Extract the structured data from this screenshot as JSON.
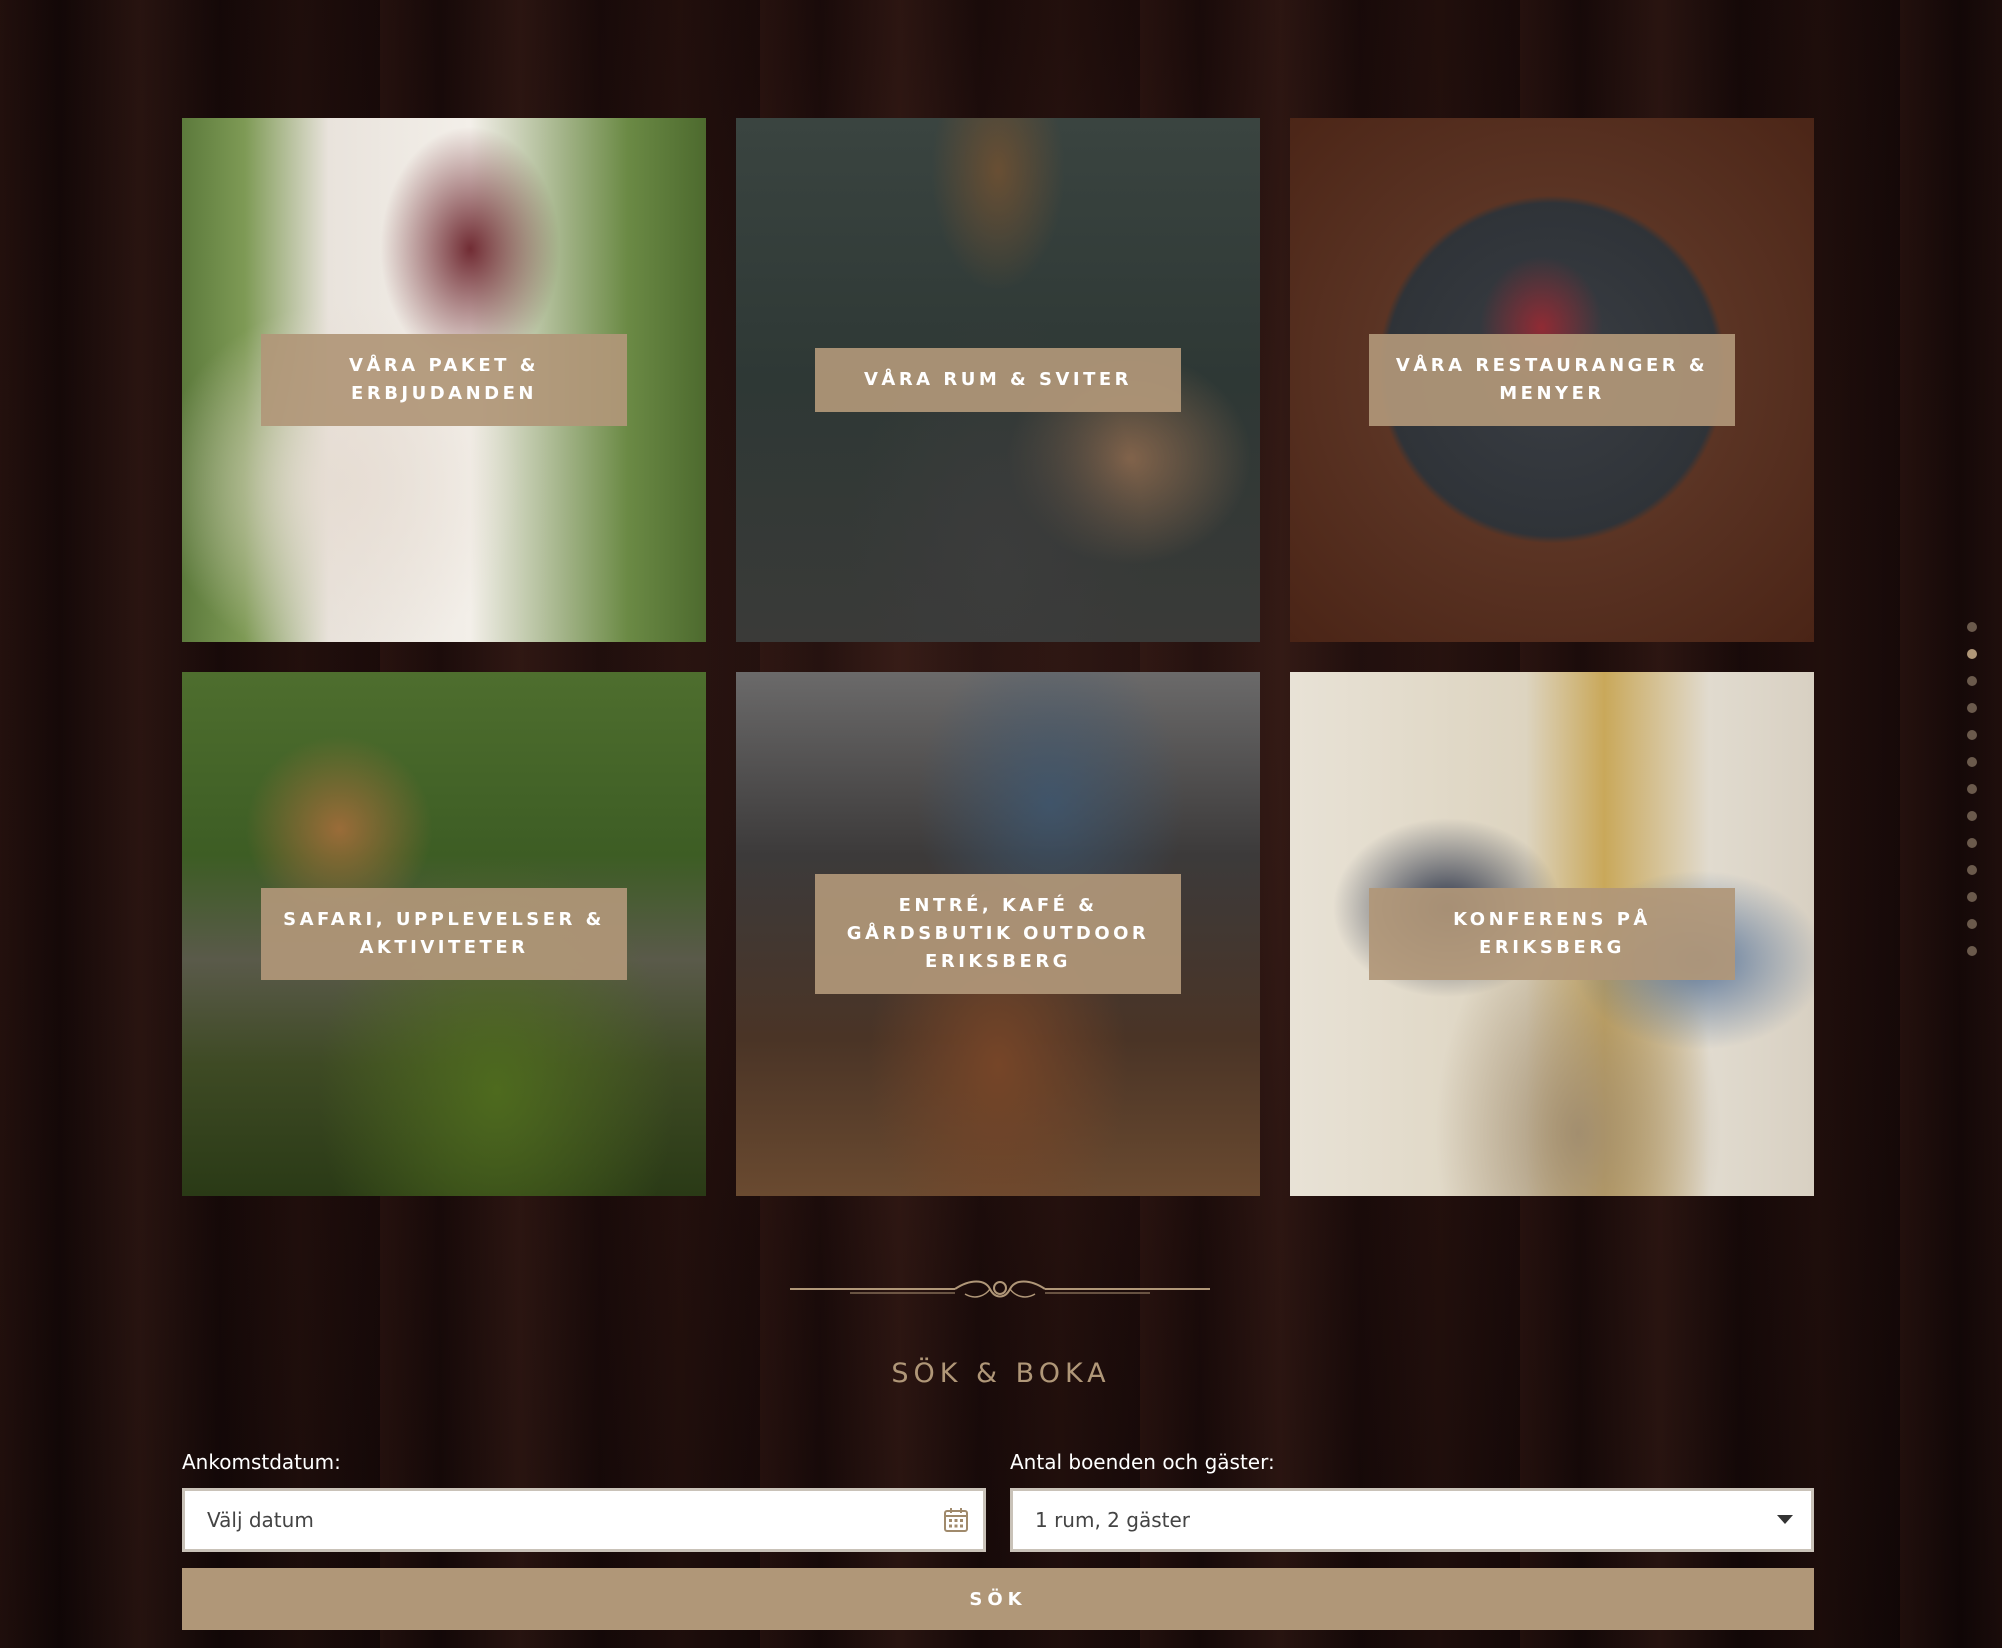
{
  "tiles": [
    {
      "label": "VÅRA PAKET & ERBJUDANDEN"
    },
    {
      "label": "VÅRA RUM & SVITER"
    },
    {
      "label": "VÅRA RESTAURANGER & MENYER"
    },
    {
      "label": "SAFARI, UPPLEVELSER & AKTIVITETER"
    },
    {
      "label": "ENTRÉ, KAFÉ & GÅRDSBUTIK OUTDOOR ERIKSBERG"
    },
    {
      "label": "KONFERENS PÅ ERIKSBERG"
    }
  ],
  "booking": {
    "title": "SÖK & BOKA",
    "arrival_label": "Ankomstdatum:",
    "arrival_placeholder": "Välj datum",
    "guests_label": "Antal boenden och gäster:",
    "guests_value": "1 rum, 2 gäster",
    "search_label": "SÖK"
  },
  "icons": {
    "date": "calendar-icon",
    "guests": "caret-down-icon",
    "divider": "ornament-divider-icon"
  },
  "colors": {
    "accent": "#b09778",
    "background": "#1a0b0a"
  },
  "pagination": {
    "count": 13,
    "active_index": 1
  }
}
